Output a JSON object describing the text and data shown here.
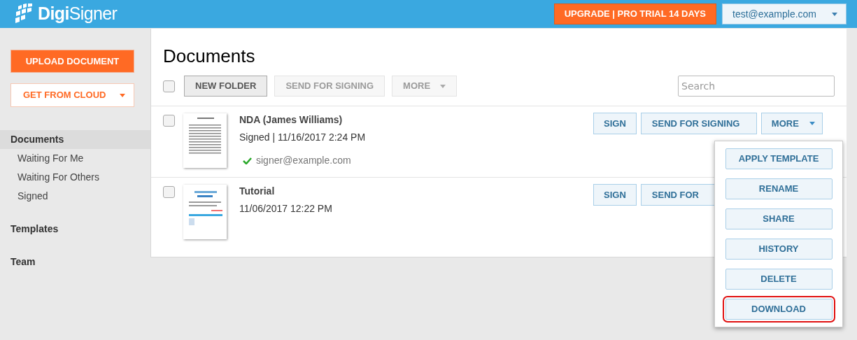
{
  "header": {
    "logo": "**Digi**Signer",
    "upgrade_button": "UPGRADE | PRO TRIAL 14 DAYS",
    "account_menu": "test@example.com"
  },
  "sidebar": {
    "upload_button": "UPLOAD DOCUMENT",
    "cloud_button": "GET FROM CLOUD",
    "items": [
      {
        "label": "Documents",
        "selected": true,
        "children": [
          {
            "label": "Waiting For Me",
            "selected": false
          },
          {
            "label": "Waiting For Others",
            "selected": false
          },
          {
            "label": "Signed",
            "selected": false
          }
        ]
      },
      {
        "label": "Templates",
        "selected": false
      },
      {
        "label": "Team",
        "selected": false
      }
    ]
  },
  "main": {
    "title": "Documents",
    "toolbar": {
      "select_all": {
        "checked": false
      },
      "buttons": [
        {
          "label": "NEW FOLDER",
          "disabled": false,
          "dropdown": false
        },
        {
          "label": "SEND FOR SIGNING",
          "disabled": true,
          "dropdown": false
        },
        {
          "label": "MORE",
          "disabled": true,
          "dropdown": true
        }
      ],
      "search": {
        "placeholder": "Search"
      }
    },
    "documents": [
      {
        "name": "NDA (James Williams)",
        "info": "Signed | 11/16/2017 2:24 PM",
        "checked": false,
        "signers": [
          {
            "email": "signer@example.com",
            "signed": true
          }
        ],
        "buttons": [
          "SIGN",
          "SEND FOR SIGNING",
          "MORE"
        ]
      },
      {
        "name": "Tutorial",
        "info": "11/06/2017 12:22 PM",
        "checked": false,
        "buttons": [
          "SIGN",
          "SEND FOR"
        ]
      }
    ],
    "more_menu": [
      {
        "label": "APPLY TEMPLATE",
        "highlighted": false
      },
      {
        "label": "RENAME",
        "highlighted": false
      },
      {
        "label": "SHARE",
        "highlighted": false
      },
      {
        "label": "HISTORY",
        "highlighted": false
      },
      {
        "label": "DELETE",
        "highlighted": false
      },
      {
        "label": "DOWNLOAD",
        "highlighted": true
      }
    ]
  }
}
